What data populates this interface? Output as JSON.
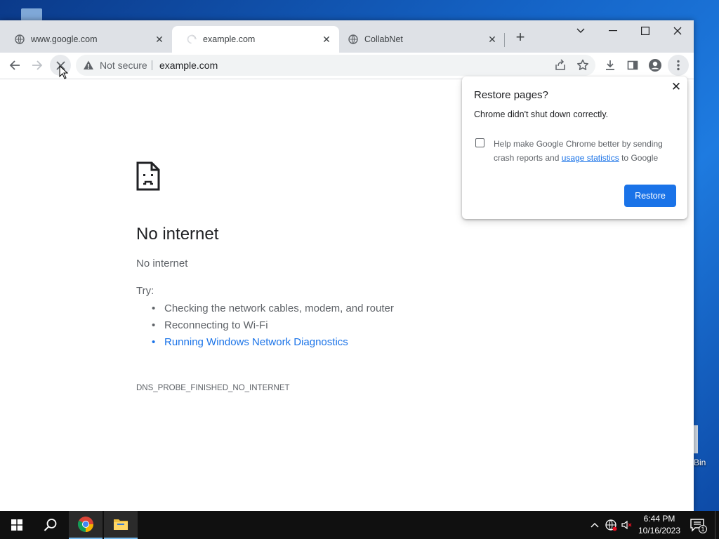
{
  "browser": {
    "tabs": [
      {
        "title": "www.google.com",
        "active": false
      },
      {
        "title": "example.com",
        "active": true,
        "loading": true
      },
      {
        "title": "CollabNet",
        "active": false
      }
    ],
    "new_tab_symbol": "+",
    "window_controls": [
      "chevron-down",
      "minimize",
      "maximize",
      "close"
    ]
  },
  "toolbar": {
    "security_label": "Not secure",
    "url": "example.com"
  },
  "error_page": {
    "title": "No internet",
    "subtitle": "No internet",
    "try_label": "Try:",
    "suggestions": [
      "Checking the network cables, modem, and router",
      "Reconnecting to Wi-Fi",
      "Running Windows Network Diagnostics"
    ],
    "error_code": "DNS_PROBE_FINISHED_NO_INTERNET"
  },
  "restore_popup": {
    "title": "Restore pages?",
    "message": "Chrome didn't shut down correctly.",
    "help_prefix": "Help make Google Chrome better by sending crash reports and ",
    "help_link": "usage statistics",
    "help_suffix": " to Google",
    "button_label": "Restore"
  },
  "desktop": {
    "recycle_bin_label": "Bin"
  },
  "taskbar": {
    "time": "6:44 PM",
    "date": "10/16/2023",
    "notification_count": "1"
  },
  "colors": {
    "accent": "#1a73e8",
    "tabstrip": "#dee1e6",
    "taskbar": "#101010"
  }
}
